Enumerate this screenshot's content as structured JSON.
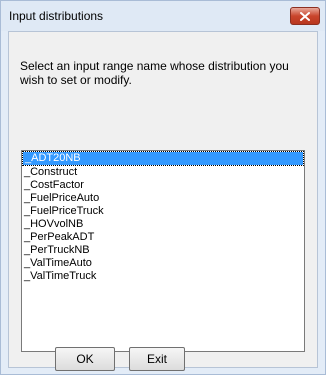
{
  "window": {
    "title": "Input distributions"
  },
  "dialog": {
    "instructions": "Select an input range name whose distribution you wish to set or modify.",
    "items": [
      "_ADT20NB",
      "_Construct",
      "_CostFactor",
      "_FuelPriceAuto",
      "_FuelPriceTruck",
      "_HOVvolNB",
      "_PerPeakADT",
      "_PerTruckNB",
      "_ValTimeAuto",
      "_ValTimeTruck"
    ],
    "selected_item": "_ADT20NB",
    "ok_label": "OK",
    "exit_label": "Exit"
  },
  "colors": {
    "selection": "#3399ff",
    "close_button": "#c9452c",
    "frame": "#e3ecf7"
  },
  "icons": {
    "close": "close-icon"
  }
}
